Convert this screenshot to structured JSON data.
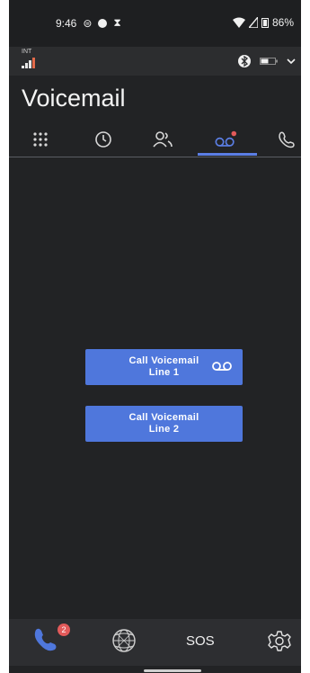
{
  "status_bar": {
    "time": "9:46",
    "battery": "86%",
    "carrier_label": "INT"
  },
  "page_title": "Voicemail",
  "tabs": [
    {
      "name": "dialpad",
      "icon": "dialpad-icon"
    },
    {
      "name": "recents",
      "icon": "clock-icon"
    },
    {
      "name": "contacts",
      "icon": "contacts-icon"
    },
    {
      "name": "voicemail",
      "icon": "voicemail-icon",
      "active": true
    },
    {
      "name": "calls",
      "icon": "phone-outline-icon"
    }
  ],
  "buttons": {
    "line1": {
      "line_a": "Call Voicemail",
      "line_b": "Line 1"
    },
    "line2": {
      "line_a": "Call Voicemail",
      "line_b": "Line 2"
    }
  },
  "bottom_nav": {
    "phone_badge": "2",
    "sos_label": "SOS"
  },
  "colors": {
    "accent": "#4f77dc",
    "background": "#222325",
    "badge": "#e25a5a"
  }
}
